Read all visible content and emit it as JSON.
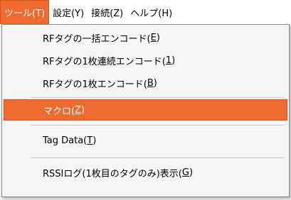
{
  "menubar": {
    "items": [
      {
        "label": "ツール(T)",
        "active": true
      },
      {
        "label": "設定(Y)"
      },
      {
        "label": "接続(Z)"
      },
      {
        "label": "ヘルプ(H)"
      }
    ]
  },
  "tools_menu": {
    "items": [
      {
        "prefix": "RFタグの一括エンコード(",
        "key": "E",
        "suffix": ")"
      },
      {
        "prefix": "RFタグの1枚連続エンコード(",
        "key": "1",
        "suffix": ")"
      },
      {
        "prefix": "RFタグの1枚エンコード(",
        "key": "B",
        "suffix": ")"
      },
      {
        "prefix": "マクロ(",
        "key": "Z",
        "suffix": ")",
        "highlighted": true
      },
      {
        "prefix": "Tag Data(",
        "key": "T",
        "suffix": ")"
      },
      {
        "prefix": "RSSIログ(1枚目のタグのみ)表示(",
        "key": "G",
        "suffix": ")"
      }
    ]
  },
  "colors": {
    "highlight": "#ef6a31",
    "menu_background": "#f5f5f5"
  }
}
